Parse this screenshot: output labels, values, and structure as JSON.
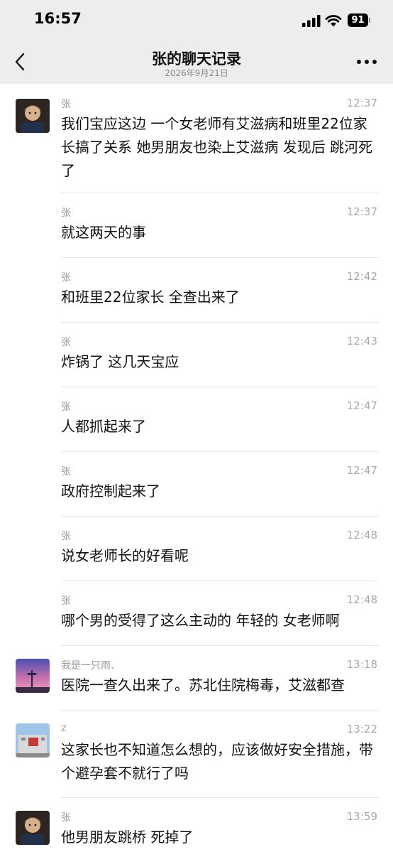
{
  "status": {
    "time": "16:57",
    "battery": "91"
  },
  "header": {
    "title": "张的聊天记录",
    "subtitle": "2026年9月21日"
  },
  "messages": [
    {
      "sender": "张",
      "time": "12:37",
      "text": "我们宝应这边 一个女老师有艾滋病和班里22位家长搞了关系 她男朋友也染上艾滋病 发现后 跳河死了",
      "avatar": "avatar-zhang-icon"
    },
    {
      "sender": "张",
      "time": "12:37",
      "text": "就这两天的事"
    },
    {
      "sender": "张",
      "time": "12:42",
      "text": "和班里22位家长 全查出来了"
    },
    {
      "sender": "张",
      "time": "12:43",
      "text": "炸锅了 这几天宝应"
    },
    {
      "sender": "张",
      "time": "12:47",
      "text": "人都抓起来了"
    },
    {
      "sender": "张",
      "time": "12:47",
      "text": "政府控制起来了"
    },
    {
      "sender": "张",
      "time": "12:48",
      "text": "说女老师长的好看呢"
    },
    {
      "sender": "张",
      "time": "12:48",
      "text": "哪个男的受得了这么主动的 年轻的 女老师啊"
    },
    {
      "sender": "我是一只雨、",
      "time": "13:18",
      "text": "医院一查久出来了。苏北住院梅毒，艾滋都查",
      "avatar": "avatar-sunset-icon"
    },
    {
      "sender": "z",
      "time": "13:22",
      "text": "这家长也不知道怎么想的，应该做好安全措施，带个避孕套不就行了吗",
      "avatar": "avatar-building-icon"
    },
    {
      "sender": "张",
      "time": "13:59",
      "text": "他男朋友跳桥 死掉了",
      "avatar": "avatar-zhang-icon"
    }
  ]
}
